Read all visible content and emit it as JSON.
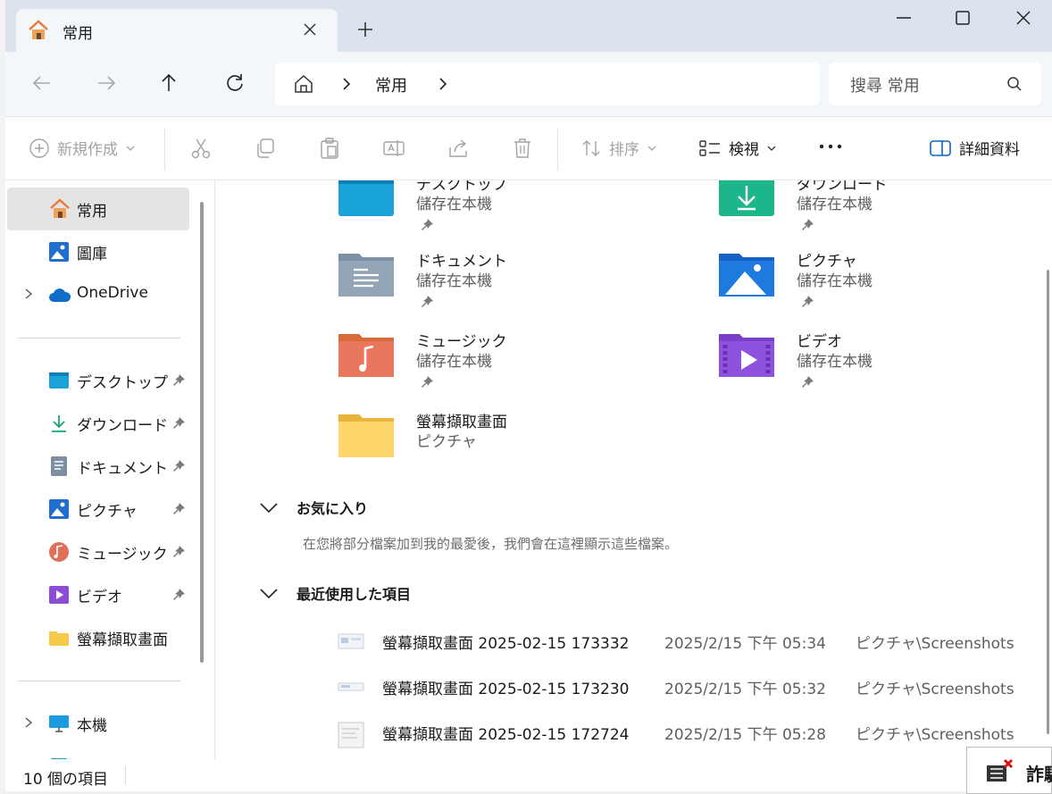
{
  "tab": {
    "title": "常用"
  },
  "address": {
    "crumb": "常用"
  },
  "search": {
    "placeholder": "搜尋 常用"
  },
  "commands": {
    "new": "新規作成",
    "sort": "排序",
    "view": "検視",
    "details": "詳細資料"
  },
  "sidebar": {
    "top": [
      {
        "label": "常用"
      },
      {
        "label": "圖庫"
      },
      {
        "label": "OneDrive"
      }
    ],
    "pinned": [
      {
        "label": "デスクトップ"
      },
      {
        "label": "ダウンロード"
      },
      {
        "label": "ドキュメント"
      },
      {
        "label": "ピクチャ"
      },
      {
        "label": "ミュージック"
      },
      {
        "label": "ビデオ"
      },
      {
        "label": "螢幕擷取畫面"
      }
    ],
    "bottom": [
      {
        "label": "本機"
      },
      {
        "label": "網路"
      }
    ]
  },
  "quick_access": [
    {
      "name": "デスクトップ",
      "sub": "儲存在本機"
    },
    {
      "name": "ダウンロード",
      "sub": "儲存在本機"
    },
    {
      "name": "ドキュメント",
      "sub": "儲存在本機"
    },
    {
      "name": "ピクチャ",
      "sub": "儲存在本機"
    },
    {
      "name": "ミュージック",
      "sub": "儲存在本機"
    },
    {
      "name": "ビデオ",
      "sub": "儲存在本機"
    },
    {
      "name": "螢幕擷取畫面",
      "sub": "ピクチャ"
    }
  ],
  "favorites": {
    "title": "お気に入り",
    "empty_message": "在您將部分檔案加到我的最愛後，我們會在這裡顯示這些檔案。"
  },
  "recent": {
    "title": "最近使用した項目",
    "items": [
      {
        "name": "螢幕擷取畫面 2025-02-15 173332",
        "date": "2025/2/15 下午 05:34",
        "location": "ピクチャ\\Screenshots"
      },
      {
        "name": "螢幕擷取畫面 2025-02-15 173230",
        "date": "2025/2/15 下午 05:32",
        "location": "ピクチャ\\Screenshots"
      },
      {
        "name": "螢幕擷取畫面 2025-02-15 172724",
        "date": "2025/2/15 下午 05:28",
        "location": "ピクチャ\\Screenshots"
      }
    ]
  },
  "status": {
    "count": "10 個の項目"
  },
  "overlay": {
    "text": "詐騙"
  },
  "colors": {
    "accent": "#0a64c8",
    "folder_yellow": "#f7c948",
    "titlebar": "#dbe4ee"
  }
}
